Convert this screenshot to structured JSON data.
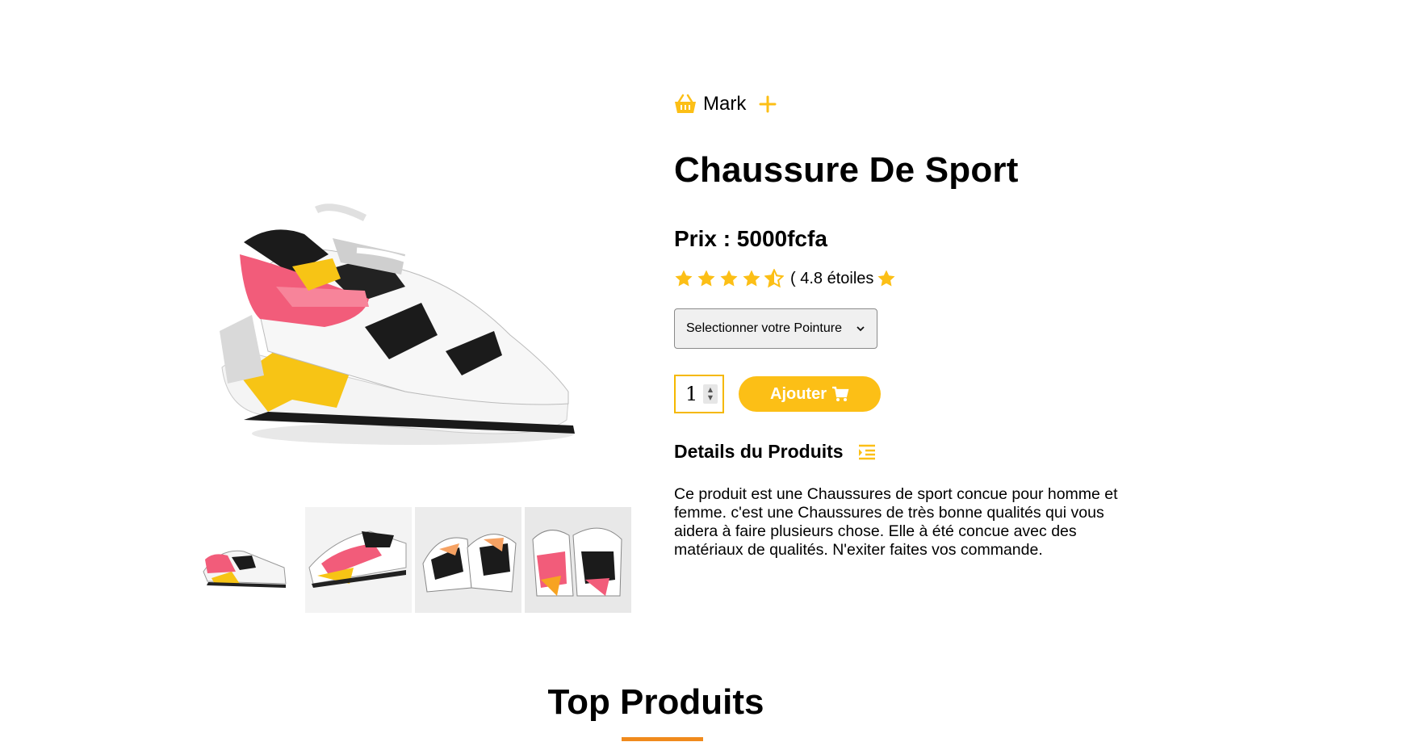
{
  "brand": {
    "name": "Mark",
    "basket_icon": "basket-icon",
    "plus_icon": "plus-icon"
  },
  "product": {
    "title": "Chaussure De Sport",
    "price_text": "Prix : 5000fcfa",
    "rating": {
      "value": 4.5,
      "text": "( 4.8 étoiles"
    },
    "size_select": {
      "selected": "Selectionner votre Pointure"
    },
    "quantity": "1",
    "add_button": "Ajouter",
    "details_heading": "Details du Produits",
    "description": "Ce produit est une Chaussures de sport concue pour homme et femme. c'est une Chaussures de très bonne qualités qui vous aidera à faire plusieurs chose. Elle à été concue avec des matériaux de qualités. N'exiter faites vos commande."
  },
  "top_section": {
    "title": "Top Produits"
  },
  "colors": {
    "accent": "#fcbf16",
    "underline": "#f08a1c"
  }
}
